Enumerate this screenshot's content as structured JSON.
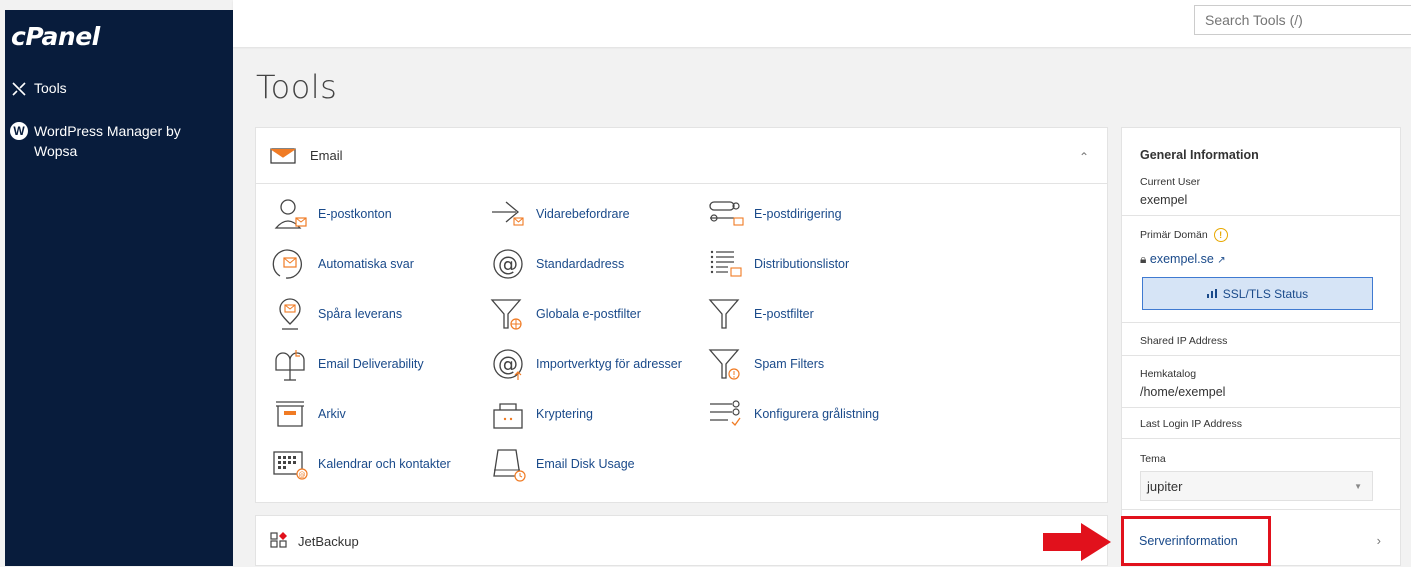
{
  "app": {
    "logo": "cPanel"
  },
  "sidebar": {
    "items": [
      {
        "label": "Tools",
        "icon": "tools-icon"
      },
      {
        "label": "WordPress Manager by Wopsa",
        "icon": "wordpress-icon"
      }
    ]
  },
  "search": {
    "placeholder": "Search Tools (/)"
  },
  "page": {
    "title": "Tools"
  },
  "email_section": {
    "title": "Email",
    "tools": [
      {
        "label": "E-postkonton",
        "icon": "email-accounts-icon"
      },
      {
        "label": "Vidarebefordrare",
        "icon": "forwarders-icon"
      },
      {
        "label": "E-postdirigering",
        "icon": "email-routing-icon"
      },
      {
        "label": "Automatiska svar",
        "icon": "autoresponders-icon"
      },
      {
        "label": "Standardadress",
        "icon": "default-address-icon"
      },
      {
        "label": "Distributionslistor",
        "icon": "mailing-lists-icon"
      },
      {
        "label": "Spåra leverans",
        "icon": "track-delivery-icon"
      },
      {
        "label": "Globala e-postfilter",
        "icon": "global-filters-icon"
      },
      {
        "label": "E-postfilter",
        "icon": "email-filters-icon"
      },
      {
        "label": "Email Deliverability",
        "icon": "deliverability-icon"
      },
      {
        "label": "Importverktyg för adresser",
        "icon": "address-importer-icon"
      },
      {
        "label": "Spam Filters",
        "icon": "spam-filters-icon"
      },
      {
        "label": "Arkiv",
        "icon": "archive-icon"
      },
      {
        "label": "Kryptering",
        "icon": "encryption-icon"
      },
      {
        "label": "Konfigurera grålistning",
        "icon": "greylisting-icon"
      },
      {
        "label": "Kalendrar och kontakter",
        "icon": "calendars-icon"
      },
      {
        "label": "Email Disk Usage",
        "icon": "disk-usage-icon"
      }
    ]
  },
  "jetbackup_section": {
    "title": "JetBackup"
  },
  "general_info": {
    "title": "General Information",
    "current_user_label": "Current User",
    "current_user": "exempel",
    "primary_domain_label": "Primär Domän",
    "primary_domain": "exempel.se",
    "ssl_button": "SSL/TLS Status",
    "shared_ip_label": "Shared IP Address",
    "home_dir_label": "Hemkatalog",
    "home_dir": "/home/exempel",
    "last_login_label": "Last Login IP Address",
    "theme_label": "Tema",
    "theme_value": "jupiter",
    "server_info": "Serverinformation"
  },
  "colors": {
    "sidebar": "#081c3c",
    "link": "#1a4a8a",
    "accent_orange": "#f07b24",
    "highlight_red": "#e1111c"
  }
}
